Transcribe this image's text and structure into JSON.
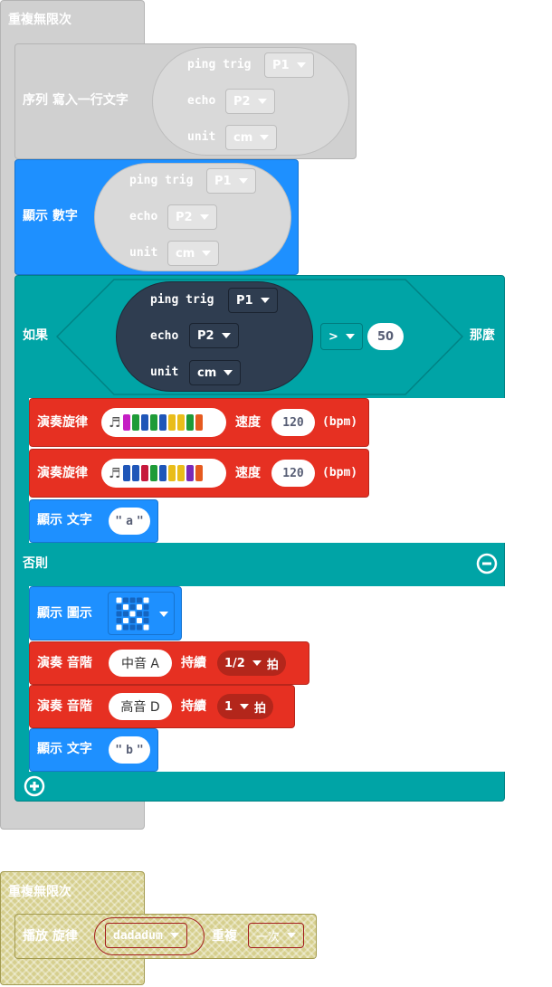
{
  "forever1": {
    "label": "重複無限次"
  },
  "serial": {
    "label": "序列 寫入一行文字",
    "ping": {
      "trig_label": "ping trig",
      "trig_value": "P1",
      "echo_label": "echo",
      "echo_value": "P2",
      "unit_label": "unit",
      "unit_value": "cm"
    }
  },
  "show_number": {
    "label": "顯示 數字",
    "ping": {
      "trig_label": "ping trig",
      "trig_value": "P1",
      "echo_label": "echo",
      "echo_value": "P2",
      "unit_label": "unit",
      "unit_value": "cm"
    }
  },
  "if_block": {
    "if_label": "如果",
    "then_label": "那麼",
    "ping": {
      "trig_label": "ping trig",
      "trig_value": "P1",
      "echo_label": "echo",
      "echo_value": "P2",
      "unit_label": "unit",
      "unit_value": "cm"
    },
    "operator": ">",
    "compare_value": "50",
    "else_label": "否則"
  },
  "melody1": {
    "label": "演奏旋律",
    "speed_label": "速度",
    "tempo": "120",
    "unit": "(bpm)",
    "colors": [
      "#c51ec4",
      "#1e9b38",
      "#1f56b8",
      "#1e9b38",
      "#1f56b8",
      "#e9bd1a",
      "#e9bd1a",
      "#1e9b38",
      "#e65a1f"
    ]
  },
  "melody2": {
    "label": "演奏旋律",
    "speed_label": "速度",
    "tempo": "120",
    "unit": "(bpm)",
    "colors": [
      "#1f56b8",
      "#1f56b8",
      "#c6193c",
      "#1e9b38",
      "#1f56b8",
      "#e9bd1a",
      "#e9bd1a",
      "#7a2bb8",
      "#e65a1f"
    ]
  },
  "show_a": {
    "label": "顯示 文字",
    "value": "a"
  },
  "show_icon": {
    "label": "顯示 圖示"
  },
  "tone1": {
    "label": "演奏 音階",
    "note": "中音 A",
    "duration_label": "持續",
    "beat": "1/2",
    "beat_unit": "拍"
  },
  "tone2": {
    "label": "演奏 音階",
    "note": "高音 D",
    "duration_label": "持續",
    "beat": "1",
    "beat_unit": "拍"
  },
  "show_b": {
    "label": "顯示 文字",
    "value": "b"
  },
  "forever2": {
    "label": "重複無限次"
  },
  "play": {
    "label": "播放 旋律",
    "melody": "dadadum",
    "repeat_label": "重複",
    "repeat_value": "一次"
  }
}
